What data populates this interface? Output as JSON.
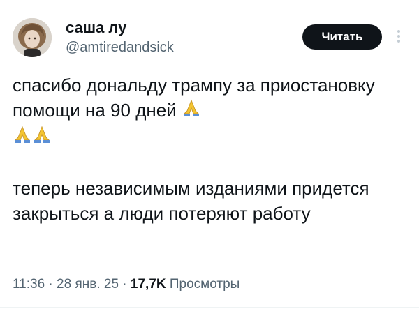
{
  "author": {
    "display_name": "саша лу",
    "handle": "@amtiredandsick",
    "avatar_icon": "profile-photo"
  },
  "header": {
    "follow_label": "Читать",
    "more_icon": "more-vertical-icon"
  },
  "tweet": {
    "paragraph_1": "спасибо дональду трампу за приостановку помощи на 90 дней",
    "paragraph_1_emoji_count": 3,
    "emoji_icon": "folded-hands-icon",
    "paragraph_2": "теперь независимым изданиями придется закрыться а люди потеряют работу"
  },
  "meta": {
    "time": "11:36",
    "separator": "·",
    "date": "28 янв. 25",
    "views_count": "17,7K",
    "views_label": "Просмотры"
  },
  "colors": {
    "text": "#0f1419",
    "secondary": "#536471",
    "button_bg": "#0f1419",
    "emoji_skin": "#f4c531",
    "emoji_cuff": "#5b8fd6"
  }
}
